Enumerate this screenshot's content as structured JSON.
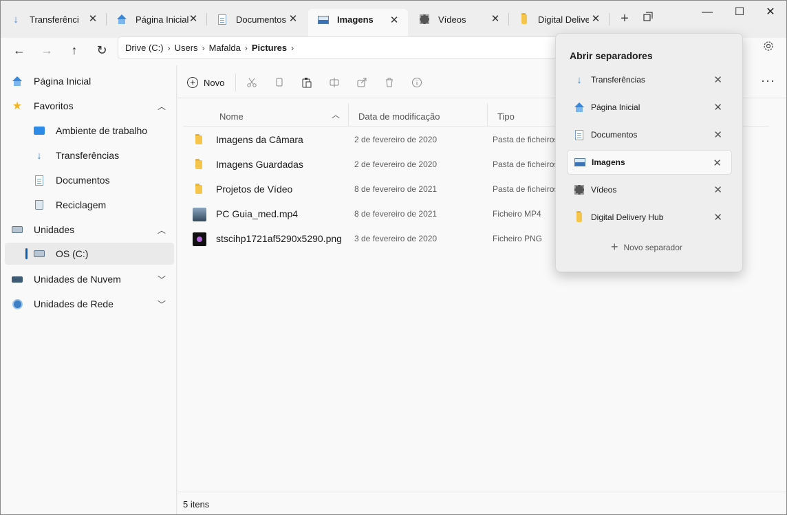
{
  "tabs": [
    {
      "label": "Transferências",
      "icon": "download-icon"
    },
    {
      "label": "Página Inicial",
      "icon": "home-icon"
    },
    {
      "label": "Documentos",
      "icon": "document-icon"
    },
    {
      "label": "Imagens",
      "icon": "pictures-icon",
      "active": true
    },
    {
      "label": "Vídeos",
      "icon": "video-icon"
    },
    {
      "label": "Digital Delive",
      "icon": "folder-icon"
    }
  ],
  "tab_close": "✕",
  "new_tab": "+",
  "window": {
    "minimize": "—",
    "maximize": "☐",
    "close": "✕"
  },
  "nav": {
    "back": "←",
    "forward": "→",
    "up": "↑",
    "refresh": "↻"
  },
  "breadcrumb": [
    "Drive (C:)",
    "Users",
    "Mafalda",
    "Pictures"
  ],
  "breadcrumb_sep": "›",
  "sidebar": {
    "home": "Página Inicial",
    "favorites": "Favoritos",
    "desktop": "Ambiente de trabalho",
    "downloads": "Transferências",
    "documents": "Documentos",
    "recycle": "Reciclagem",
    "drives": "Unidades",
    "osdrive": "OS (C:)",
    "cloud": "Unidades de Nuvem",
    "network": "Unidades de Rede"
  },
  "toolbar": {
    "new_label": "Novo",
    "more": "···"
  },
  "columns": {
    "name": "Nome",
    "date": "Data de modificação",
    "type": "Tipo"
  },
  "files": [
    {
      "name": "Imagens da Câmara",
      "date": "2 de fevereiro de 2020",
      "type": "Pasta de ficheiros",
      "kind": "folder"
    },
    {
      "name": "Imagens Guardadas",
      "date": "2 de fevereiro de 2020",
      "type": "Pasta de ficheiros",
      "kind": "folder"
    },
    {
      "name": "Projetos de Vídeo",
      "date": "8 de fevereiro de 2021",
      "type": "Pasta de ficheiros",
      "kind": "folder"
    },
    {
      "name": "PC Guia_med.mp4",
      "date": "8 de fevereiro de 2021",
      "type": "Ficheiro MP4",
      "kind": "video"
    },
    {
      "name": "stscihp1721af5290x5290.png",
      "date": "3 de fevereiro de 2020",
      "type": "Ficheiro PNG",
      "kind": "png"
    }
  ],
  "status": "5 itens",
  "flyout": {
    "title": "Abrir separadores",
    "items": [
      "Transferências",
      "Página Inicial",
      "Documentos",
      "Imagens",
      "Vídeos",
      "Digital Delivery Hub"
    ],
    "new_label": "Novo separador"
  }
}
